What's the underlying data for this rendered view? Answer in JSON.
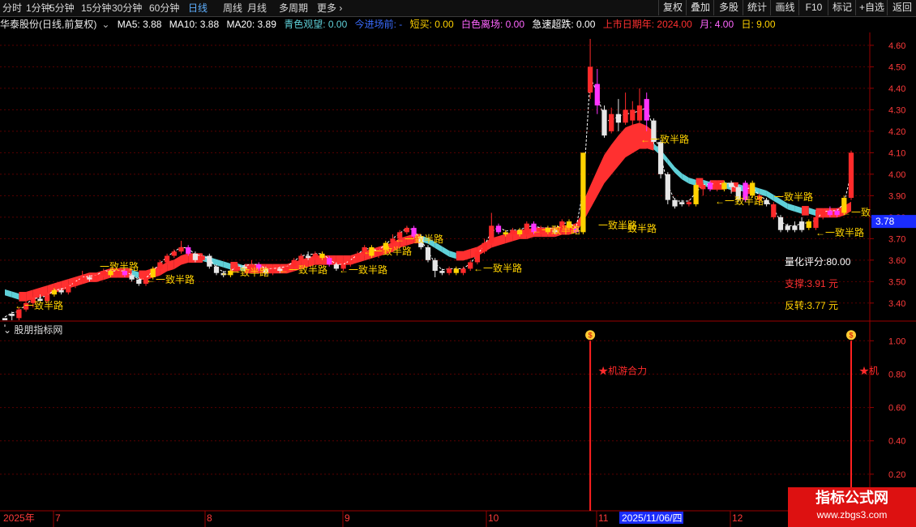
{
  "toolbar": {
    "periods": [
      "分时",
      "1分钟",
      "5分钟",
      "15分钟",
      "30分钟",
      "60分钟",
      "日线",
      "周线",
      "月线",
      "多周期",
      "更多"
    ],
    "active_period": "日线",
    "right_buttons": [
      "复权",
      "叠加",
      "多股",
      "统计",
      "画线",
      "F10",
      "标记",
      "+自选",
      "返回"
    ]
  },
  "legend": {
    "stock_title": "华泰股份(日线,前复权)",
    "ma5": "MA5: 3.88",
    "ma10": "MA10: 3.88",
    "ma20": "MA20: 3.89",
    "qingse": "青色观望: 0.00",
    "entry": "今进场前: -",
    "short_buy": "短买: 0.00",
    "white_exit": "白色离场: 0.00",
    "drop": "急速超跌: 0.00",
    "listing_date": "上市日期年: 2024.00",
    "month": "月: 4.00",
    "day": "日: 9.00"
  },
  "colors": {
    "up": "#ff2a2a",
    "down": "#e6e6e6",
    "yellow": "#ffd200",
    "magenta": "#ff33ff",
    "cyan": "#5fd0d8",
    "red_band": "#ff3030",
    "axis": "#9a0000",
    "signal": "#ff2020"
  },
  "price_axis": {
    "ticks": [
      "4.60",
      "4.50",
      "4.40",
      "4.30",
      "4.20",
      "4.10",
      "4.00",
      "3.90",
      "3.80",
      "3.70",
      "3.60",
      "3.50",
      "3.40"
    ],
    "current": "3.78",
    "range": [
      3.32,
      4.66
    ]
  },
  "annotation_label": "←一致半路",
  "annotations_short": "一致半路",
  "annotation_cut": "←一致",
  "info_panel": {
    "score": "量化评分:80.00",
    "support": "支撑:3.91 元",
    "reversal": "反转:3.77 元"
  },
  "sub_panel": {
    "title": "股朋指标网",
    "ticks": [
      "1.00",
      "0.80",
      "0.60",
      "0.40",
      "0.20"
    ],
    "signal_label": "★机游合力",
    "signal_label_cut": "★机",
    "signal_icon": "money-bag"
  },
  "date_axis": {
    "year": "2025年",
    "months": [
      "7",
      "8",
      "9",
      "10",
      "11",
      "12"
    ],
    "cursor_date": "2025/11/06/四"
  },
  "watermark": {
    "title": "指标公式网",
    "url": "www.zbgs3.com"
  },
  "chart_data": {
    "type": "candlestick",
    "ylim": [
      3.32,
      4.66
    ],
    "candles": [
      [
        3.32,
        3.33,
        3.29,
        3.3,
        "d"
      ],
      [
        3.35,
        3.34,
        3.32,
        3.36,
        "d"
      ],
      [
        3.33,
        3.37,
        3.32,
        3.38,
        "u"
      ],
      [
        3.37,
        3.4,
        3.36,
        3.41,
        "u"
      ],
      [
        3.4,
        3.42,
        3.38,
        3.43,
        "u"
      ],
      [
        3.42,
        3.41,
        3.4,
        3.44,
        "d"
      ],
      [
        3.41,
        3.44,
        3.4,
        3.45,
        "u"
      ],
      [
        3.44,
        3.46,
        3.43,
        3.47,
        "y"
      ],
      [
        3.46,
        3.45,
        3.44,
        3.47,
        "d"
      ],
      [
        3.45,
        3.48,
        3.44,
        3.49,
        "u"
      ],
      [
        3.48,
        3.5,
        3.47,
        3.51,
        "u"
      ],
      [
        3.5,
        3.52,
        3.49,
        3.55,
        "u"
      ],
      [
        3.52,
        3.51,
        3.5,
        3.53,
        "d"
      ],
      [
        3.51,
        3.53,
        3.5,
        3.54,
        "u"
      ],
      [
        3.53,
        3.55,
        3.52,
        3.56,
        "u"
      ],
      [
        3.55,
        3.53,
        3.52,
        3.56,
        "y"
      ],
      [
        3.53,
        3.55,
        3.52,
        3.56,
        "u"
      ],
      [
        3.55,
        3.53,
        3.52,
        3.56,
        "m"
      ],
      [
        3.53,
        3.51,
        3.5,
        3.54,
        "d"
      ],
      [
        3.51,
        3.49,
        3.48,
        3.52,
        "d"
      ],
      [
        3.49,
        3.52,
        3.48,
        3.53,
        "u"
      ],
      [
        3.52,
        3.56,
        3.51,
        3.57,
        "y"
      ],
      [
        3.56,
        3.59,
        3.55,
        3.6,
        "u"
      ],
      [
        3.59,
        3.62,
        3.58,
        3.63,
        "u"
      ],
      [
        3.62,
        3.64,
        3.61,
        3.65,
        "u"
      ],
      [
        3.64,
        3.66,
        3.63,
        3.69,
        "u"
      ],
      [
        3.66,
        3.63,
        3.62,
        3.67,
        "m"
      ],
      [
        3.63,
        3.6,
        3.59,
        3.64,
        "d"
      ],
      [
        3.6,
        3.62,
        3.59,
        3.63,
        "u"
      ],
      [
        3.62,
        3.57,
        3.56,
        3.63,
        "d"
      ],
      [
        3.57,
        3.54,
        3.53,
        3.58,
        "d"
      ],
      [
        3.54,
        3.53,
        3.52,
        3.55,
        "d"
      ],
      [
        3.53,
        3.55,
        3.52,
        3.56,
        "y"
      ],
      [
        3.55,
        3.57,
        3.54,
        3.58,
        "u"
      ],
      [
        3.57,
        3.56,
        3.55,
        3.58,
        "d"
      ],
      [
        3.56,
        3.58,
        3.55,
        3.6,
        "u"
      ],
      [
        3.58,
        3.56,
        3.55,
        3.59,
        "m"
      ],
      [
        3.56,
        3.54,
        3.53,
        3.57,
        "d"
      ],
      [
        3.54,
        3.56,
        3.53,
        3.57,
        "u"
      ],
      [
        3.56,
        3.55,
        3.54,
        3.57,
        "d"
      ],
      [
        3.55,
        3.57,
        3.54,
        3.58,
        "u"
      ],
      [
        3.57,
        3.6,
        3.56,
        3.61,
        "u"
      ],
      [
        3.6,
        3.62,
        3.59,
        3.63,
        "u"
      ],
      [
        3.62,
        3.61,
        3.6,
        3.64,
        "d"
      ],
      [
        3.61,
        3.63,
        3.6,
        3.64,
        "u"
      ],
      [
        3.63,
        3.61,
        3.6,
        3.64,
        "y"
      ],
      [
        3.61,
        3.58,
        3.57,
        3.62,
        "m"
      ],
      [
        3.58,
        3.56,
        3.55,
        3.59,
        "d"
      ],
      [
        3.56,
        3.58,
        3.55,
        3.59,
        "u"
      ],
      [
        3.58,
        3.6,
        3.57,
        3.61,
        "u"
      ],
      [
        3.6,
        3.63,
        3.59,
        3.64,
        "u"
      ],
      [
        3.63,
        3.66,
        3.62,
        3.67,
        "u"
      ],
      [
        3.66,
        3.62,
        3.61,
        3.67,
        "y"
      ],
      [
        3.62,
        3.65,
        3.61,
        3.66,
        "u"
      ],
      [
        3.65,
        3.68,
        3.64,
        3.69,
        "y"
      ],
      [
        3.68,
        3.7,
        3.67,
        3.72,
        "u"
      ],
      [
        3.7,
        3.73,
        3.69,
        3.74,
        "u"
      ],
      [
        3.73,
        3.75,
        3.72,
        3.76,
        "u"
      ],
      [
        3.75,
        3.71,
        3.7,
        3.76,
        "m"
      ],
      [
        3.71,
        3.66,
        3.65,
        3.72,
        "d"
      ],
      [
        3.66,
        3.6,
        3.59,
        3.67,
        "d"
      ],
      [
        3.6,
        3.55,
        3.52,
        3.61,
        "d"
      ],
      [
        3.55,
        3.54,
        3.53,
        3.56,
        "d"
      ],
      [
        3.54,
        3.56,
        3.53,
        3.57,
        "u"
      ],
      [
        3.56,
        3.54,
        3.53,
        3.57,
        "y"
      ],
      [
        3.54,
        3.56,
        3.53,
        3.57,
        "u"
      ],
      [
        3.56,
        3.59,
        3.55,
        3.6,
        "u"
      ],
      [
        3.59,
        3.64,
        3.58,
        3.65,
        "u"
      ],
      [
        3.64,
        3.68,
        3.63,
        3.7,
        "u"
      ],
      [
        3.68,
        3.76,
        3.67,
        3.82,
        "u"
      ],
      [
        3.76,
        3.73,
        3.72,
        3.77,
        "m"
      ],
      [
        3.73,
        3.72,
        3.71,
        3.74,
        "y"
      ],
      [
        3.72,
        3.74,
        3.71,
        3.75,
        "u"
      ],
      [
        3.74,
        3.72,
        3.71,
        3.75,
        "y"
      ],
      [
        3.72,
        3.77,
        3.71,
        3.78,
        "u"
      ],
      [
        3.77,
        3.73,
        3.72,
        3.78,
        "m"
      ],
      [
        3.73,
        3.75,
        3.72,
        3.76,
        "u"
      ],
      [
        3.75,
        3.73,
        3.72,
        3.76,
        "y"
      ],
      [
        3.73,
        3.74,
        3.72,
        3.76,
        "d"
      ],
      [
        3.74,
        3.78,
        3.73,
        3.79,
        "u"
      ],
      [
        3.78,
        3.75,
        3.74,
        3.79,
        "y"
      ],
      [
        3.75,
        3.73,
        3.72,
        3.76,
        "m"
      ],
      [
        3.73,
        4.1,
        3.72,
        4.1,
        "y"
      ],
      [
        4.38,
        4.5,
        4.35,
        4.63,
        "u"
      ],
      [
        4.42,
        4.32,
        4.28,
        4.49,
        "m"
      ],
      [
        4.3,
        4.18,
        4.17,
        4.32,
        "d"
      ],
      [
        4.2,
        4.28,
        4.19,
        4.31,
        "u"
      ],
      [
        4.28,
        4.24,
        4.2,
        4.35,
        "d"
      ],
      [
        4.24,
        4.3,
        4.23,
        4.38,
        "u"
      ],
      [
        4.3,
        4.25,
        4.22,
        4.34,
        "u"
      ],
      [
        4.25,
        4.32,
        4.24,
        4.4,
        "u"
      ],
      [
        4.35,
        4.25,
        4.2,
        4.38,
        "m"
      ],
      [
        4.25,
        4.15,
        4.14,
        4.26,
        "d"
      ],
      [
        4.15,
        4.0,
        3.98,
        4.16,
        "d"
      ],
      [
        4.0,
        3.88,
        3.86,
        4.01,
        "d"
      ],
      [
        3.88,
        3.85,
        3.84,
        3.89,
        "d"
      ],
      [
        3.86,
        3.87,
        3.85,
        3.88,
        "d"
      ],
      [
        3.87,
        3.86,
        3.85,
        3.88,
        "u"
      ],
      [
        3.86,
        3.95,
        3.85,
        3.96,
        "y"
      ],
      [
        3.95,
        3.93,
        3.9,
        3.96,
        "u"
      ],
      [
        3.93,
        3.96,
        3.92,
        3.97,
        "m"
      ],
      [
        3.96,
        3.93,
        3.92,
        3.97,
        "u"
      ],
      [
        3.93,
        3.96,
        3.92,
        3.97,
        "y"
      ],
      [
        3.96,
        3.94,
        3.91,
        3.97,
        "d"
      ],
      [
        3.94,
        3.88,
        3.87,
        3.95,
        "d"
      ],
      [
        3.88,
        3.96,
        3.87,
        3.97,
        "m"
      ],
      [
        3.96,
        3.9,
        3.89,
        3.97,
        "y"
      ],
      [
        3.9,
        3.88,
        3.86,
        3.91,
        "u"
      ],
      [
        3.88,
        3.86,
        3.85,
        3.89,
        "d"
      ],
      [
        3.86,
        3.8,
        3.79,
        3.87,
        "u"
      ],
      [
        3.8,
        3.74,
        3.73,
        3.81,
        "d"
      ],
      [
        3.74,
        3.76,
        3.73,
        3.77,
        "d"
      ],
      [
        3.76,
        3.74,
        3.73,
        3.78,
        "d"
      ],
      [
        3.74,
        3.78,
        3.73,
        3.8,
        "d"
      ],
      [
        3.78,
        3.75,
        3.74,
        3.79,
        "y"
      ],
      [
        3.75,
        3.8,
        3.74,
        3.83,
        "u"
      ],
      [
        3.8,
        3.83,
        3.79,
        3.84,
        "u"
      ],
      [
        3.83,
        3.81,
        3.8,
        3.85,
        "m"
      ],
      [
        3.81,
        3.83,
        3.8,
        3.84,
        "m"
      ],
      [
        3.82,
        3.89,
        3.81,
        3.9,
        "y"
      ],
      [
        3.89,
        4.1,
        3.88,
        4.11,
        "u"
      ]
    ],
    "ma_values": [
      3.45,
      3.44,
      3.43,
      3.43,
      3.44,
      3.45,
      3.46,
      3.47,
      3.48,
      3.49,
      3.5,
      3.51,
      3.52,
      3.52,
      3.53,
      3.54,
      3.54,
      3.54,
      3.54,
      3.53,
      3.53,
      3.54,
      3.55,
      3.57,
      3.58,
      3.6,
      3.61,
      3.61,
      3.61,
      3.6,
      3.59,
      3.58,
      3.57,
      3.57,
      3.56,
      3.56,
      3.56,
      3.56,
      3.56,
      3.56,
      3.56,
      3.57,
      3.58,
      3.59,
      3.6,
      3.6,
      3.6,
      3.6,
      3.6,
      3.6,
      3.61,
      3.62,
      3.63,
      3.64,
      3.65,
      3.66,
      3.68,
      3.69,
      3.7,
      3.7,
      3.69,
      3.67,
      3.65,
      3.63,
      3.62,
      3.62,
      3.63,
      3.64,
      3.66,
      3.68,
      3.69,
      3.7,
      3.71,
      3.72,
      3.72,
      3.73,
      3.73,
      3.73,
      3.73,
      3.74,
      3.74,
      3.75,
      3.8,
      3.86,
      3.92,
      3.98,
      4.02,
      4.06,
      4.1,
      4.12,
      4.14,
      4.14,
      4.13,
      4.1,
      4.06,
      4.02,
      3.99,
      3.97,
      3.96,
      3.96,
      3.95,
      3.95,
      3.95,
      3.94,
      3.94,
      3.93,
      3.93,
      3.92,
      3.91,
      3.89,
      3.87,
      3.85,
      3.84,
      3.83,
      3.83,
      3.82,
      3.82,
      3.82,
      3.82,
      3.83,
      3.85
    ],
    "signals": [
      {
        "x": 83,
        "value": 1.0,
        "label": "★机游合力"
      },
      {
        "x": 120,
        "value": 1.0,
        "label": "★机"
      }
    ]
  }
}
